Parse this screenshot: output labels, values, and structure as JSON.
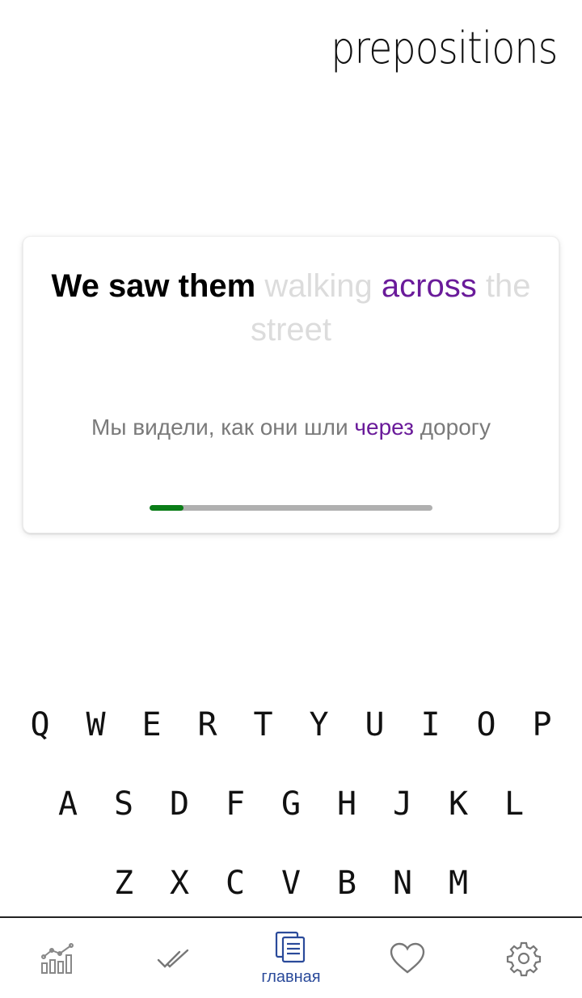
{
  "header": {
    "topic": "prepositions"
  },
  "card": {
    "sentence": {
      "known": "We saw them",
      "hidden": "walking",
      "target": "across",
      "hidden_tail": "the street"
    },
    "translation": {
      "before": "Мы видели, как они шли",
      "target": "через",
      "after": "дорогу"
    },
    "progress": 0.12,
    "colors": {
      "target": "#6a1b9a",
      "progress_fill": "#0a7d17",
      "progress_track": "#b0b0b0"
    }
  },
  "keyboard": {
    "rows": [
      [
        "Q",
        "W",
        "E",
        "R",
        "T",
        "Y",
        "U",
        "I",
        "O",
        "P"
      ],
      [
        "A",
        "S",
        "D",
        "F",
        "G",
        "H",
        "J",
        "K",
        "L"
      ],
      [
        "Z",
        "X",
        "C",
        "V",
        "B",
        "N",
        "M"
      ]
    ]
  },
  "bottom_nav": {
    "items": [
      {
        "icon": "statistics-icon",
        "label": ""
      },
      {
        "icon": "double-check-icon",
        "label": ""
      },
      {
        "icon": "cards-icon",
        "label": "главная",
        "active": true
      },
      {
        "icon": "heart-icon",
        "label": ""
      },
      {
        "icon": "gear-icon",
        "label": ""
      }
    ],
    "active_color": "#2a4a9a"
  }
}
